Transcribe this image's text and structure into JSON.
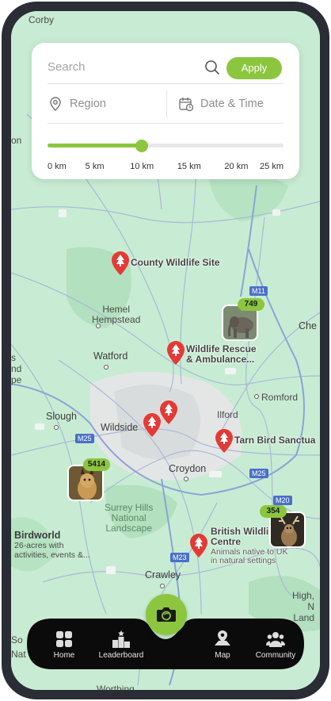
{
  "search": {
    "placeholder": "Search",
    "apply_label": "Apply"
  },
  "filters": {
    "region_label": "Region",
    "datetime_label": "Date & Time"
  },
  "distance_slider": {
    "value_km": 10,
    "max_km": 25,
    "ticks": [
      "0 km",
      "5 km",
      "10 km",
      "15 km",
      "20 km",
      "25 km"
    ]
  },
  "map": {
    "places": {
      "corby": "Corby",
      "hemel": "Hemel\nHempstead",
      "watford": "Watford",
      "slough": "Slough",
      "wildside": "Wildside",
      "ilford": "Ilford",
      "romford": "Romford",
      "croydon": "Croydon",
      "crawley": "Crawley",
      "surrey_hills": "Surrey Hills\nNational\nLandscape",
      "birdworld": "Birdworld",
      "birdworld_desc": "26-acres with\nactivities, events &...",
      "che": "Che",
      "high": "High,\nN\nLand",
      "edge_on": "on",
      "edge_s": "s",
      "edge_nd": "nd",
      "edge_pe": "pe",
      "edge_so": "So",
      "edge_nat": "Nat",
      "worthing": "Worthing"
    },
    "roads": {
      "m11": "M11",
      "m25_west": "M25",
      "m25_east": "M25",
      "m20": "M20",
      "m23": "M23"
    },
    "pois": [
      {
        "name": "County Wildlife Site",
        "desc": ""
      },
      {
        "name": "Wildlife Rescue\n& Ambulance...",
        "desc": ""
      },
      {
        "name": "Tarn Bird Sanctua",
        "desc": ""
      },
      {
        "name": "British Wildli\nCentre",
        "desc": "Animals native to UK\nin natural settings"
      },
      {
        "name": "",
        "desc": ""
      },
      {
        "name": "",
        "desc": ""
      }
    ],
    "clusters": [
      {
        "count": "749",
        "subject": "elephant"
      },
      {
        "count": "5414",
        "subject": "lynx"
      },
      {
        "count": "354",
        "subject": "deer"
      }
    ]
  },
  "colors": {
    "accent": "#8cc63f",
    "map_base": "#c8ecd3",
    "pin": "#e53935",
    "nav_bg": "#0b0b0b"
  },
  "nav": {
    "items": [
      {
        "label": "Home",
        "icon": "home-grid-icon"
      },
      {
        "label": "Leaderboard",
        "icon": "podium-icon"
      },
      {
        "label": "Map",
        "icon": "map-pin-icon"
      },
      {
        "label": "Community",
        "icon": "people-icon"
      }
    ],
    "camera_icon": "camera-icon"
  }
}
